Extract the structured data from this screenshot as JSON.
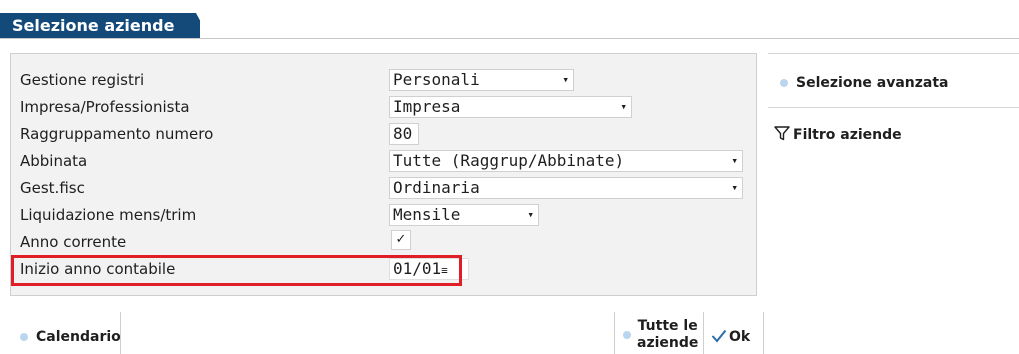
{
  "window": {
    "title": "Selezione aziende"
  },
  "form": {
    "gestione_registri": {
      "label": "Gestione registri",
      "value": "Personali"
    },
    "impresa_professionista": {
      "label": "Impresa/Professionista",
      "value": "Impresa"
    },
    "raggruppamento_numero": {
      "label": "Raggruppamento numero",
      "value": "80"
    },
    "abbinata": {
      "label": "Abbinata",
      "value": "Tutte (Raggrup/Abbinate)"
    },
    "gest_fisc": {
      "label": "Gest.fisc",
      "value": "Ordinaria"
    },
    "liquidazione": {
      "label": "Liquidazione mens/trim",
      "value": "Mensile"
    },
    "anno_corrente": {
      "label": "Anno corrente",
      "checked": true
    },
    "inizio_anno": {
      "label": "Inizio anno contabile",
      "value": "01/01"
    }
  },
  "sidebar": {
    "selezione_avanzata": "Selezione avanzata",
    "filtro_aziende": "Filtro aziende"
  },
  "footer": {
    "calendario": "Calendario",
    "tutte_le": "Tutte le",
    "aziende": "aziende",
    "ok": "Ok"
  },
  "colors": {
    "accent": "#134a7a",
    "highlight": "#e01e25",
    "dot": "#b9d6ee"
  }
}
